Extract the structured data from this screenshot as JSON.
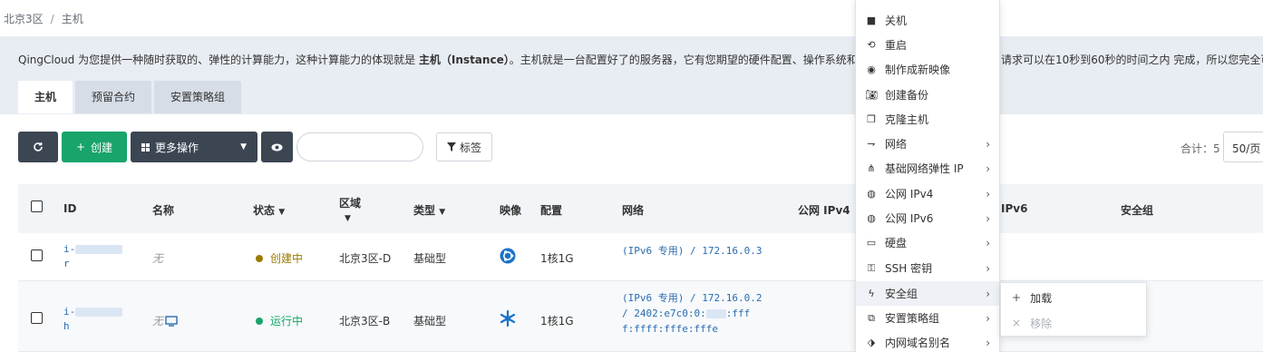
{
  "breadcrumb": {
    "region": "北京3区",
    "sep": "/",
    "page": "主机"
  },
  "intro": {
    "text_before": "QingCloud 为您提供一种随时获取的、弹性的计算能力，这种计算能力的体现就是 ",
    "text_bold": "主机（Instance）",
    "text_after": "。主机就是一台配置好了的服务器，它有您期望的硬件配置、操作系统和",
    "text_right": "请求可以在10秒到60秒的时间之内 完成，所以您完全可"
  },
  "tabs": [
    {
      "label": "主机",
      "active": true
    },
    {
      "label": "预留合约",
      "active": false
    },
    {
      "label": "安置策略组",
      "active": false
    }
  ],
  "toolbar": {
    "refresh_icon": "refresh-icon",
    "create_label": "创建",
    "more_label": "更多操作",
    "eye_icon": "eye-icon",
    "search_placeholder": "",
    "tag_label": "标签"
  },
  "pagination": {
    "total": "合计：5",
    "per_page": "50/页"
  },
  "table": {
    "headers": {
      "id": "ID",
      "name": "名称",
      "status": "状态",
      "zone": "区域",
      "type": "类型",
      "image": "映像",
      "config": "配置",
      "network": "网络",
      "ipv4": "公网 IPv4",
      "ipv6": "IPv6",
      "sg": "安全组"
    },
    "rows": [
      {
        "id_prefix": "i-",
        "id_suffix": "r",
        "name": "无",
        "status": "创建中",
        "status_color": "#9a7a00",
        "zone": "北京3区-D",
        "type": "基础型",
        "image_icon": "ubuntu-icon",
        "config": "1核1G",
        "network_line1": "(IPv6 专用) / 172.16.0.3"
      },
      {
        "id_prefix": "i-",
        "id_suffix": "h",
        "name": "无",
        "status": "运行中",
        "status_color": "#18a46a",
        "zone": "北京3区-B",
        "type": "基础型",
        "image_icon": "snowflake-icon",
        "config": "1核1G",
        "network_line1": "(IPv6 专用) / 172.16.0.2",
        "network_line2_a": "/ 2402:e7c0:0:",
        "network_line2_b": ":fff",
        "network_line3": "f:ffff:fffe:fffe"
      }
    ]
  },
  "context_menu": {
    "items": [
      {
        "label": "关机",
        "icon": "stop-icon",
        "has_sub": false
      },
      {
        "label": "重启",
        "icon": "restart-icon",
        "has_sub": false
      },
      {
        "label": "制作成新映像",
        "icon": "disc-icon",
        "has_sub": false
      },
      {
        "label": "创建备份",
        "icon": "camera-icon",
        "has_sub": false
      },
      {
        "label": "克隆主机",
        "icon": "clone-icon",
        "has_sub": false
      },
      {
        "label": "网络",
        "icon": "network-icon",
        "has_sub": true
      },
      {
        "label": "基础网络弹性 IP",
        "icon": "eip-icon",
        "has_sub": true
      },
      {
        "label": "公网 IPv4",
        "icon": "globe-icon",
        "has_sub": true
      },
      {
        "label": "公网 IPv6",
        "icon": "globe-icon",
        "has_sub": true
      },
      {
        "label": "硬盘",
        "icon": "disk-icon",
        "has_sub": true
      },
      {
        "label": "SSH 密钥",
        "icon": "key-icon",
        "has_sub": true
      },
      {
        "label": "安全组",
        "icon": "bolt-icon",
        "has_sub": true,
        "hover": true
      },
      {
        "label": "安置策略组",
        "icon": "group-icon",
        "has_sub": true
      },
      {
        "label": "内网域名别名",
        "icon": "tag-icon",
        "has_sub": true
      }
    ],
    "submenu": [
      {
        "label": "加载",
        "icon": "plus-icon",
        "disabled": false
      },
      {
        "label": "移除",
        "icon": "x-icon",
        "disabled": true
      }
    ]
  }
}
